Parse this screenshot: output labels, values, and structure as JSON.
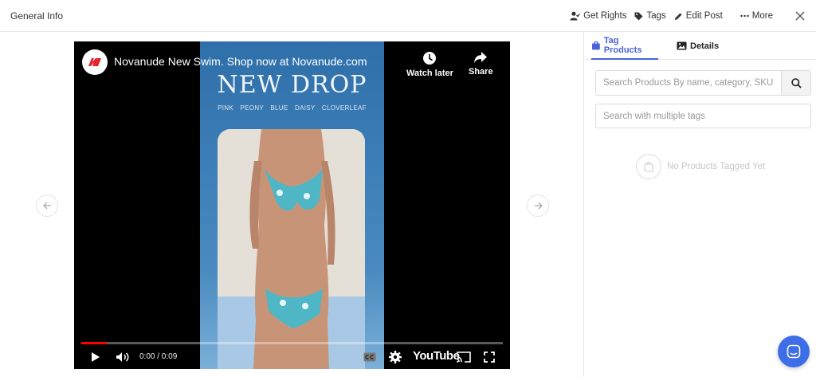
{
  "header": {
    "title": "General Info",
    "actions": {
      "get_rights": "Get Rights",
      "tags": "Tags",
      "edit_post": "Edit Post",
      "more": "More"
    }
  },
  "video": {
    "channel_title": "Novanude New Swim. Shop now at Novanude.com",
    "watch_later": "Watch later",
    "share": "Share",
    "art": {
      "headline": "NEW DROP",
      "subline": "PINK PEONY   BLUE DAISY   CLOVERLEAF"
    },
    "time": "0:00 / 0:09",
    "progress": 0.06,
    "youtube_label": "YouTube",
    "brand_color": "#ff0000"
  },
  "sidebar": {
    "tabs": {
      "tag_products": "Tag Products",
      "details": "Details"
    },
    "search_placeholder": "Search Products By name, category, SKU",
    "tags_placeholder": "Search with multiple tags",
    "empty_text": "No Products Tagged Yet"
  },
  "colors": {
    "accent": "#4a64d8",
    "chat": "#3d6ee8"
  }
}
